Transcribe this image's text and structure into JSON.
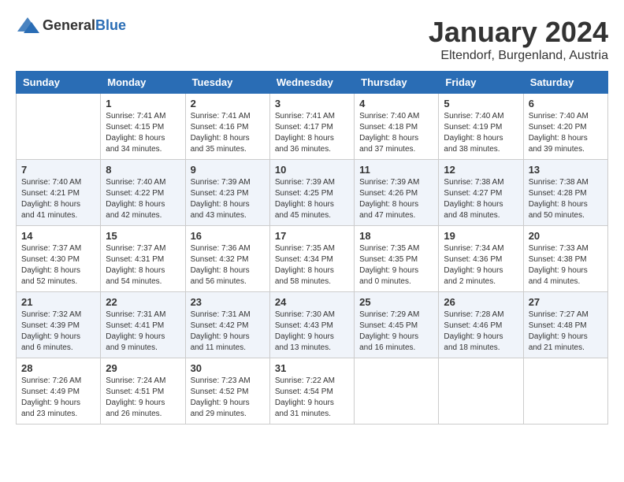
{
  "header": {
    "logo_general": "General",
    "logo_blue": "Blue",
    "month_year": "January 2024",
    "location": "Eltendorf, Burgenland, Austria"
  },
  "days_of_week": [
    "Sunday",
    "Monday",
    "Tuesday",
    "Wednesday",
    "Thursday",
    "Friday",
    "Saturday"
  ],
  "weeks": [
    [
      {
        "day": "",
        "info": ""
      },
      {
        "day": "1",
        "info": "Sunrise: 7:41 AM\nSunset: 4:15 PM\nDaylight: 8 hours\nand 34 minutes."
      },
      {
        "day": "2",
        "info": "Sunrise: 7:41 AM\nSunset: 4:16 PM\nDaylight: 8 hours\nand 35 minutes."
      },
      {
        "day": "3",
        "info": "Sunrise: 7:41 AM\nSunset: 4:17 PM\nDaylight: 8 hours\nand 36 minutes."
      },
      {
        "day": "4",
        "info": "Sunrise: 7:40 AM\nSunset: 4:18 PM\nDaylight: 8 hours\nand 37 minutes."
      },
      {
        "day": "5",
        "info": "Sunrise: 7:40 AM\nSunset: 4:19 PM\nDaylight: 8 hours\nand 38 minutes."
      },
      {
        "day": "6",
        "info": "Sunrise: 7:40 AM\nSunset: 4:20 PM\nDaylight: 8 hours\nand 39 minutes."
      }
    ],
    [
      {
        "day": "7",
        "info": "Sunrise: 7:40 AM\nSunset: 4:21 PM\nDaylight: 8 hours\nand 41 minutes."
      },
      {
        "day": "8",
        "info": "Sunrise: 7:40 AM\nSunset: 4:22 PM\nDaylight: 8 hours\nand 42 minutes."
      },
      {
        "day": "9",
        "info": "Sunrise: 7:39 AM\nSunset: 4:23 PM\nDaylight: 8 hours\nand 43 minutes."
      },
      {
        "day": "10",
        "info": "Sunrise: 7:39 AM\nSunset: 4:25 PM\nDaylight: 8 hours\nand 45 minutes."
      },
      {
        "day": "11",
        "info": "Sunrise: 7:39 AM\nSunset: 4:26 PM\nDaylight: 8 hours\nand 47 minutes."
      },
      {
        "day": "12",
        "info": "Sunrise: 7:38 AM\nSunset: 4:27 PM\nDaylight: 8 hours\nand 48 minutes."
      },
      {
        "day": "13",
        "info": "Sunrise: 7:38 AM\nSunset: 4:28 PM\nDaylight: 8 hours\nand 50 minutes."
      }
    ],
    [
      {
        "day": "14",
        "info": "Sunrise: 7:37 AM\nSunset: 4:30 PM\nDaylight: 8 hours\nand 52 minutes."
      },
      {
        "day": "15",
        "info": "Sunrise: 7:37 AM\nSunset: 4:31 PM\nDaylight: 8 hours\nand 54 minutes."
      },
      {
        "day": "16",
        "info": "Sunrise: 7:36 AM\nSunset: 4:32 PM\nDaylight: 8 hours\nand 56 minutes."
      },
      {
        "day": "17",
        "info": "Sunrise: 7:35 AM\nSunset: 4:34 PM\nDaylight: 8 hours\nand 58 minutes."
      },
      {
        "day": "18",
        "info": "Sunrise: 7:35 AM\nSunset: 4:35 PM\nDaylight: 9 hours\nand 0 minutes."
      },
      {
        "day": "19",
        "info": "Sunrise: 7:34 AM\nSunset: 4:36 PM\nDaylight: 9 hours\nand 2 minutes."
      },
      {
        "day": "20",
        "info": "Sunrise: 7:33 AM\nSunset: 4:38 PM\nDaylight: 9 hours\nand 4 minutes."
      }
    ],
    [
      {
        "day": "21",
        "info": "Sunrise: 7:32 AM\nSunset: 4:39 PM\nDaylight: 9 hours\nand 6 minutes."
      },
      {
        "day": "22",
        "info": "Sunrise: 7:31 AM\nSunset: 4:41 PM\nDaylight: 9 hours\nand 9 minutes."
      },
      {
        "day": "23",
        "info": "Sunrise: 7:31 AM\nSunset: 4:42 PM\nDaylight: 9 hours\nand 11 minutes."
      },
      {
        "day": "24",
        "info": "Sunrise: 7:30 AM\nSunset: 4:43 PM\nDaylight: 9 hours\nand 13 minutes."
      },
      {
        "day": "25",
        "info": "Sunrise: 7:29 AM\nSunset: 4:45 PM\nDaylight: 9 hours\nand 16 minutes."
      },
      {
        "day": "26",
        "info": "Sunrise: 7:28 AM\nSunset: 4:46 PM\nDaylight: 9 hours\nand 18 minutes."
      },
      {
        "day": "27",
        "info": "Sunrise: 7:27 AM\nSunset: 4:48 PM\nDaylight: 9 hours\nand 21 minutes."
      }
    ],
    [
      {
        "day": "28",
        "info": "Sunrise: 7:26 AM\nSunset: 4:49 PM\nDaylight: 9 hours\nand 23 minutes."
      },
      {
        "day": "29",
        "info": "Sunrise: 7:24 AM\nSunset: 4:51 PM\nDaylight: 9 hours\nand 26 minutes."
      },
      {
        "day": "30",
        "info": "Sunrise: 7:23 AM\nSunset: 4:52 PM\nDaylight: 9 hours\nand 29 minutes."
      },
      {
        "day": "31",
        "info": "Sunrise: 7:22 AM\nSunset: 4:54 PM\nDaylight: 9 hours\nand 31 minutes."
      },
      {
        "day": "",
        "info": ""
      },
      {
        "day": "",
        "info": ""
      },
      {
        "day": "",
        "info": ""
      }
    ]
  ]
}
